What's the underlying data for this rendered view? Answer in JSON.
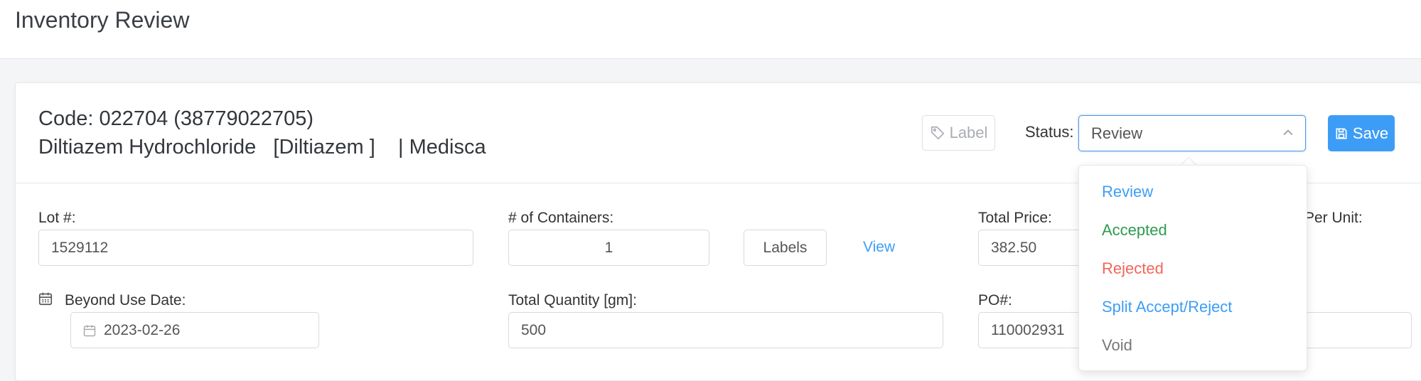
{
  "page": {
    "title": "Inventory Review"
  },
  "header": {
    "code_line": "Code: 022704 (38779022705)",
    "name_line": "Diltiazem Hydrochloride   [Diltiazem ]    | Medisca",
    "label_button": "Label",
    "status_label": "Status:",
    "status_value": "Review",
    "save_button": "Save"
  },
  "status_options": [
    {
      "label": "Review",
      "color": "#3d9df6"
    },
    {
      "label": "Accepted",
      "color": "#2e9b4e"
    },
    {
      "label": "Rejected",
      "color": "#f2655a"
    },
    {
      "label": "Split Accept/Reject",
      "color": "#3d9df6"
    },
    {
      "label": "Void",
      "color": "#777777"
    }
  ],
  "form": {
    "lot_label": "Lot #:",
    "lot_value": "1529112",
    "containers_label": "# of Containers:",
    "containers_value": "1",
    "labels_button": "Labels",
    "view_link": "View",
    "total_price_label": "Total Price:",
    "total_price_value": "382.50",
    "per_unit_label": "Per Unit:",
    "bud_label": "Beyond Use Date:",
    "bud_value": "2023-02-26",
    "total_qty_label": "Total Quantity [gm]:",
    "total_qty_value": "500",
    "po_label": "PO#:",
    "po_value": "110002931"
  },
  "icons": {
    "label": "tag-icon",
    "status_chevron": "chevron-up-icon",
    "save": "save-icon",
    "bud": "calendar-icon",
    "bud_input": "calendar-icon"
  },
  "colors": {
    "accent": "#3d9df6"
  }
}
